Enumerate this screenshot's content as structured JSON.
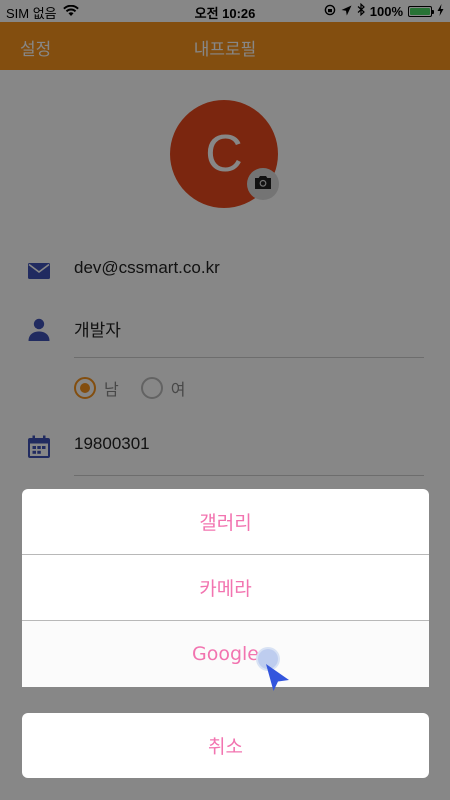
{
  "status_bar": {
    "carrier": "SIM 없음",
    "time": "오전 10:26",
    "battery": "100%",
    "battery_level": 1.0
  },
  "nav": {
    "left_label": "설정",
    "title": "내프로필"
  },
  "profile": {
    "avatar_initial": "C",
    "email": "dev@cssmart.co.kr",
    "name": "개발자",
    "gender_male": "남",
    "gender_female": "여",
    "gender_selected": "남",
    "birthdate": "19800301"
  },
  "action_sheet": {
    "items": [
      {
        "label": "갤러리"
      },
      {
        "label": "카메라"
      },
      {
        "label": "Google"
      }
    ],
    "cancel_label": "취소"
  },
  "colors": {
    "nav": "#f7941d",
    "avatar": "#e8491d",
    "accent_text": "#f274b0",
    "icon_blue": "#3f51b5"
  },
  "icons": [
    "wifi-icon",
    "lock-rotation-icon",
    "location-arrow-icon",
    "bluetooth-icon",
    "charging-icon",
    "camera-icon",
    "mail-icon",
    "person-icon",
    "calendar-icon",
    "cursor-icon"
  ]
}
